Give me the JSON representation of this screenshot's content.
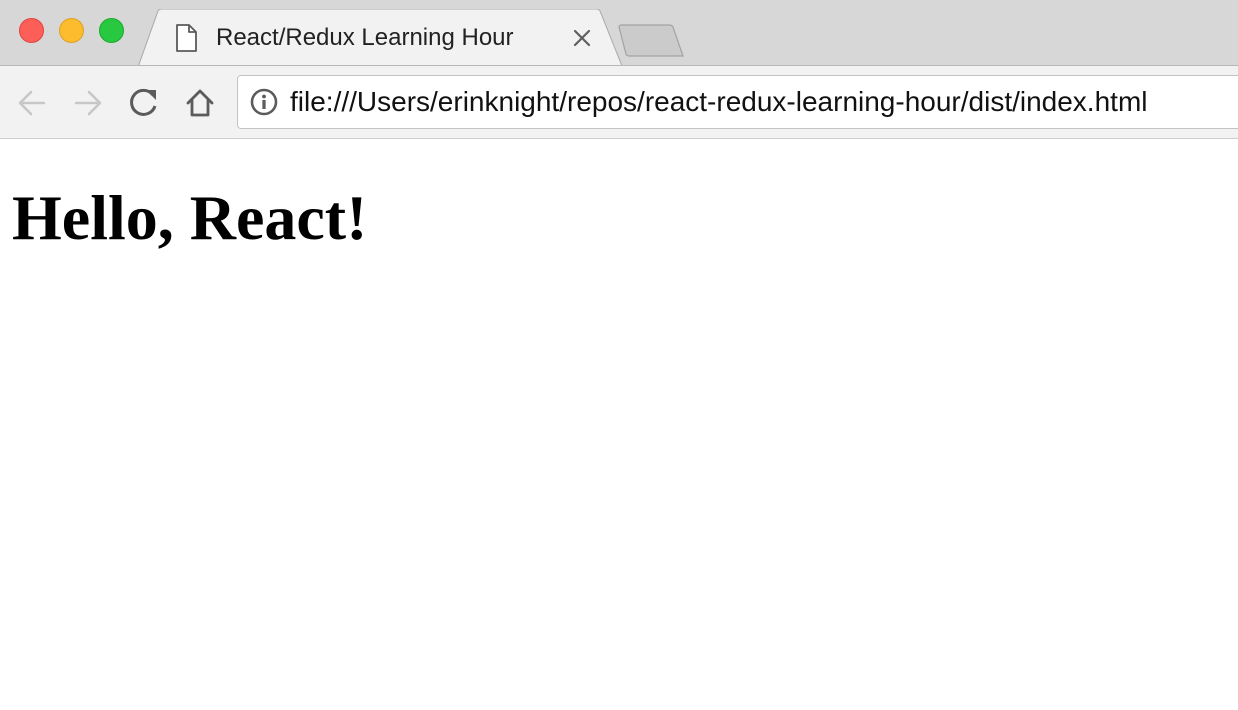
{
  "window": {
    "tab": {
      "title": "React/Redux Learning Hour",
      "favicon": "document-icon",
      "close_icon": "close-icon"
    },
    "new_tab_icon": "new-tab-icon"
  },
  "toolbar": {
    "back_icon": "back-arrow-icon",
    "forward_icon": "forward-arrow-icon",
    "reload_icon": "reload-icon",
    "home_icon": "home-icon",
    "address_bar": {
      "security_icon": "info-icon",
      "url": "file:///Users/erinknight/repos/react-redux-learning-hour/dist/index.html"
    }
  },
  "page": {
    "heading": "Hello, React!"
  },
  "colors": {
    "traffic_close": "#fc5f57",
    "traffic_minimize": "#fdbc2e",
    "traffic_maximize": "#28c840",
    "tabstrip_background": "#d7d7d7",
    "toolbar_background": "#f2f2f2"
  }
}
